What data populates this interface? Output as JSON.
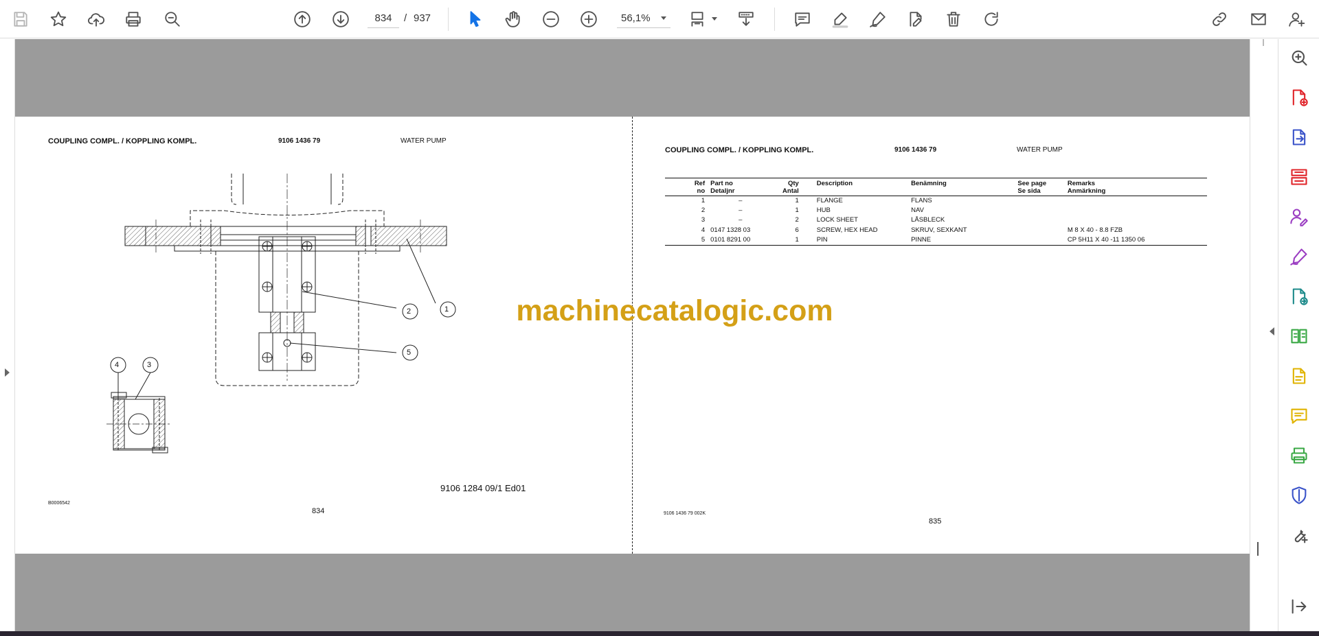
{
  "toolbar": {
    "icons": [
      "save-icon",
      "star-icon",
      "upload-icon",
      "print-icon",
      "search-zoom-icon",
      "prev-page-icon",
      "next-page-icon",
      "select-cursor-icon",
      "hand-icon",
      "zoom-out-icon",
      "zoom-in-icon",
      "fit-page-icon",
      "scroll-mode-icon",
      "comment-icon",
      "highlight-icon",
      "sign-icon",
      "edit-pdf-icon",
      "delete-icon",
      "rotate-icon",
      "share-link-icon",
      "email-icon",
      "account-icon"
    ],
    "current_page": "834",
    "page_separator": "/",
    "total_pages": "937",
    "zoom": "56,1%"
  },
  "left_page": {
    "title": "COUPLING COMPL. / KOPPLING KOMPL.",
    "part_no": "9106 1436 79",
    "section": "WATER PUMP",
    "callouts": [
      "1",
      "2",
      "5",
      "4",
      "3"
    ],
    "drawing_ref": "9106 1284 09/1  Ed01",
    "image_code": "B0006542",
    "page_number": "834"
  },
  "right_page": {
    "title": "COUPLING COMPL. / KOPPLING KOMPL.",
    "part_no": "9106 1436 79",
    "section": "WATER PUMP",
    "table": {
      "headers": {
        "ref_1": "Ref",
        "ref_2": "no",
        "part_1": "Part no",
        "part_2": "Detaljnr",
        "qty_1": "Qty",
        "qty_2": "Antal",
        "desc": "Description",
        "ben": "Benämning",
        "see_1": "See page",
        "see_2": "Se sida",
        "rem_1": "Remarks",
        "rem_2": "Anmärkning"
      },
      "rows": [
        {
          "ref": "1",
          "part": "–",
          "qty": "1",
          "desc": "FLANGE",
          "ben": "FLANS",
          "see": "",
          "rem": ""
        },
        {
          "ref": "2",
          "part": "–",
          "qty": "1",
          "desc": "HUB",
          "ben": "NAV",
          "see": "",
          "rem": ""
        },
        {
          "ref": "3",
          "part": "–",
          "qty": "2",
          "desc": "LOCK SHEET",
          "ben": "LÅSBLECK",
          "see": "",
          "rem": ""
        },
        {
          "ref": "4",
          "part": "0147 1328 03",
          "qty": "6",
          "desc": "SCREW, HEX HEAD",
          "ben": "SKRUV, SEXKANT",
          "see": "",
          "rem": "M 8 X 40 - 8.8 FZB"
        },
        {
          "ref": "5",
          "part": "0101 8291 00",
          "qty": "1",
          "desc": "PIN",
          "ben": "PINNE",
          "see": "",
          "rem": "CP  5H11 X 40 -11 1350 06"
        }
      ]
    },
    "doc_code": "9106 1436 79  002K",
    "page_number": "835"
  },
  "watermark": "machinecatalogic.com",
  "right_tools": {
    "icons": [
      "zoom-panel-icon",
      "create-pdf-icon",
      "export-pdf-icon",
      "organize-pages-icon",
      "request-signature-icon",
      "fill-sign-icon",
      "send-review-icon",
      "compare-files-icon",
      "scan-ocr-icon",
      "comment-tool-icon",
      "print-production-icon",
      "protect-icon",
      "more-tools-icon",
      "collapse-panel-icon"
    ],
    "colors": {
      "red": "#e0242a",
      "blue": "#3a53c9",
      "purple": "#9b3ec2",
      "teal": "#1c8a8a",
      "green": "#3aa845",
      "yellow": "#e0b300",
      "gray": "#505050"
    }
  }
}
